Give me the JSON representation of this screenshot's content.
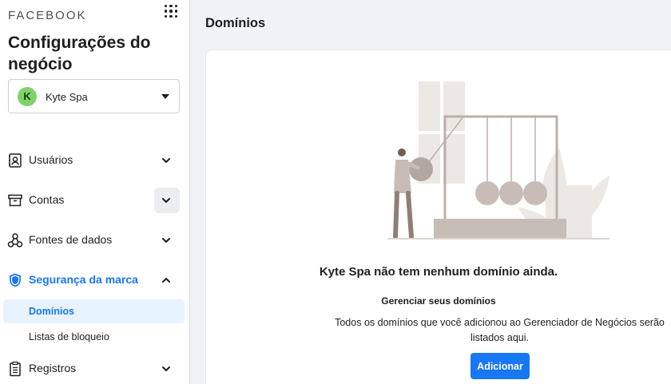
{
  "brand": "FACEBOOK",
  "title": "Configurações do negócio",
  "account": {
    "initial": "K",
    "name": "Kyte Spa"
  },
  "nav": {
    "users": "Usuários",
    "accounts": "Contas",
    "data_sources": "Fontes de dados",
    "brand_safety": "Segurança da marca",
    "domains": "Domínios",
    "block_lists": "Listas de bloqueio",
    "logs": "Registros"
  },
  "main": {
    "page_title": "Domínios",
    "empty_title": "Kyte Spa não tem nenhum domínio ainda.",
    "empty_subtitle": "Gerenciar seus domínios",
    "empty_description": "Todos os domínios que você adicionou ao Gerenciador de Negócios serão listados aqui.",
    "add_button": "Adicionar"
  },
  "colors": {
    "accent": "#1877f2",
    "selected_bg": "#e7f3ff",
    "avatar": "#7ed26b"
  },
  "icons": [
    "apps-grid-icon",
    "dropdown-caret-icon",
    "users-badge-icon",
    "archive-box-icon",
    "data-sources-icon",
    "shield-icon",
    "clipboard-icon",
    "chevron-down-icon",
    "chevron-up-icon"
  ]
}
